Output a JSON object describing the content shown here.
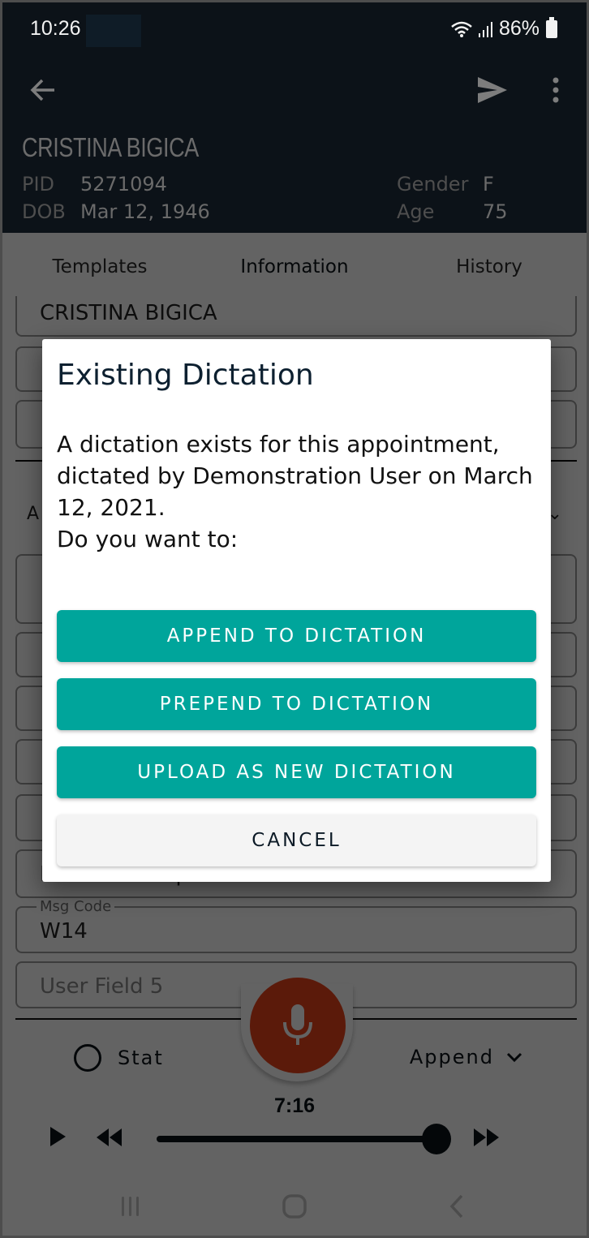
{
  "status_bar": {
    "time": "10:26",
    "battery": "86%",
    "icons": [
      "wifi-icon",
      "signal-icon",
      "battery-icon"
    ]
  },
  "toolbar": {
    "back_icon": "arrow-left-icon",
    "send_icon": "send-icon",
    "more_icon": "more-vertical-icon"
  },
  "patient": {
    "name": "CRISTINA BIGICA",
    "pid_label": "PID",
    "pid": "5271094",
    "dob_label": "DOB",
    "dob": "Mar 12, 1946",
    "gender_label": "Gender",
    "gender": "F",
    "age_label": "Age",
    "age": "75"
  },
  "tabs": [
    {
      "label": "Templates",
      "active": false
    },
    {
      "label": "Information",
      "active": true
    },
    {
      "label": "History",
      "active": false
    }
  ],
  "form": {
    "name_value": "CRISTINA BIGICA",
    "section_letter": "A",
    "visit_value": "ENT Follow-up",
    "msg_code_label": "Msg Code",
    "msg_code_value": "W14",
    "user_field_5_placeholder": "User Field 5"
  },
  "bottom_bar": {
    "stat_label": "Stat",
    "mode_label": "Append",
    "timer": "7:16",
    "playback_progress": 1.0
  },
  "dialog": {
    "title": "Existing Dictation",
    "body_line1": "A dictation exists for this appointment, dictated by Demonstration User on March 12, 2021.",
    "body_line2": "Do you want to:",
    "buttons": {
      "append": "APPEND TO DICTATION",
      "prepend": "PREPEND TO DICTATION",
      "upload_new": "UPLOAD AS NEW DICTATION",
      "cancel": "CANCEL"
    }
  },
  "colors": {
    "primary_teal": "#00a59b",
    "header_dark": "#0c1218",
    "mic_orange": "#e9431c",
    "cancel_bg": "#f4f4f4"
  }
}
